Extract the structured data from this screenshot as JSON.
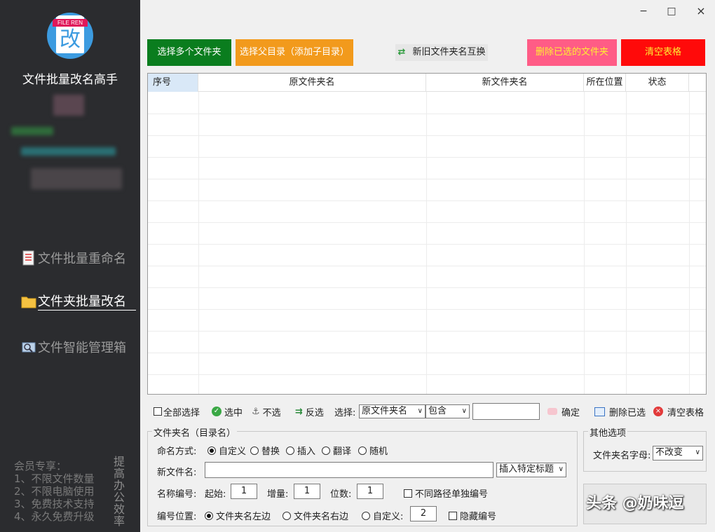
{
  "sidebar": {
    "logo_tag": "FILE REN",
    "logo_glyph": "改",
    "app_title": "文件批量改名高手",
    "nav": [
      {
        "label": "文件批量重命名"
      },
      {
        "label": "文件夹批量改名"
      },
      {
        "label": "文件智能管理箱"
      }
    ],
    "member_lines": [
      "会员专享：",
      "1、不限文件数量",
      "2、不限电脑使用",
      "3、免费技术支持",
      "4、永久免费升级"
    ],
    "slogan": "提高办公效率"
  },
  "window": {
    "minimize": "−",
    "maximize": "□",
    "close": "×"
  },
  "toolbar": {
    "select_folders": "选择多个文件夹",
    "select_parent": "选择父目录（添加子目录）",
    "swap_names": "新旧文件夹名互换",
    "delete_selected": "删除已选的文件夹",
    "clear_table": "清空表格"
  },
  "table": {
    "columns": [
      "序号",
      "原文件夹名",
      "新文件夹名",
      "所在位置",
      "状态"
    ],
    "rows": []
  },
  "selection_bar": {
    "select_all": "全部选择",
    "check": "选中",
    "uncheck": "不选",
    "invert": "反选",
    "select_label": "选择:",
    "field_value": "原文件夹名",
    "match_value": "包含",
    "filter_text": "",
    "confirm": "确定",
    "delete_selected": "删除已选",
    "clear_table": "清空表格"
  },
  "rename_group": {
    "title": "文件夹名（目录名）",
    "mode_label": "命名方式:",
    "modes": [
      {
        "label": "自定义",
        "selected": true
      },
      {
        "label": "替换",
        "selected": false
      },
      {
        "label": "插入",
        "selected": false
      },
      {
        "label": "翻译",
        "selected": false
      },
      {
        "label": "随机",
        "selected": false
      }
    ],
    "new_name_label": "新文件名:",
    "new_name_value": "",
    "insert_title": "插入特定标题",
    "numbering_label": "名称编号:",
    "start_label": "起始:",
    "start_value": "1",
    "step_label": "增量:",
    "step_value": "1",
    "digits_label": "位数:",
    "digits_value": "1",
    "separate_label": "不同路径单独编号",
    "position_label": "编号位置:",
    "positions": [
      {
        "label": "文件夹名左边",
        "selected": true
      },
      {
        "label": "文件夹名右边",
        "selected": false
      },
      {
        "label": "自定义:",
        "selected": false
      }
    ],
    "custom_pos_value": "2",
    "hide_number_label": "隐藏编号"
  },
  "other_group": {
    "title": "其他选项",
    "letters_label": "文件夹名字母:",
    "letters_value": "不改变"
  },
  "watermark": "头条 @奶味逗",
  "colors": {
    "sidebar_bg": "#2b2c2f",
    "green": "#0a7d1e",
    "orange": "#f29a1c",
    "pink": "#ff5c86",
    "red": "#ff0a0a"
  }
}
